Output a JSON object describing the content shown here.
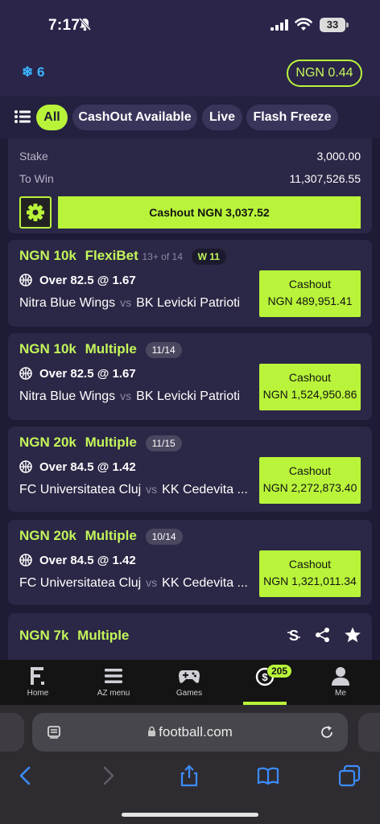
{
  "status_bar": {
    "time": "7:17",
    "battery": "33"
  },
  "header": {
    "freeze_count": "6",
    "balance": "NGN 0.44"
  },
  "filters": [
    {
      "label": "All",
      "active": true
    },
    {
      "label": "CashOut Available",
      "active": false
    },
    {
      "label": "Live",
      "active": false
    },
    {
      "label": "Flash Freeze",
      "active": false
    }
  ],
  "top_card": {
    "stake_label": "Stake",
    "stake_value": "3,000.00",
    "towin_label": "To Win",
    "towin_value": "11,307,526.55",
    "cashout_label": "Cashout NGN 3,037.52"
  },
  "bets": [
    {
      "amount": "NGN 10k",
      "type": "FlexiBet",
      "sub": "13+ of 14",
      "badge": "W 11",
      "selection": "Over 82.5 @ 1.67",
      "home": "Nitra Blue Wings",
      "vs": "vs",
      "away": "BK Levicki Patrioti",
      "cashout_label": "Cashout",
      "cashout_value": "NGN 489,951.41"
    },
    {
      "amount": "NGN 10k",
      "type": "Multiple",
      "badge": "11/14",
      "selection": "Over 82.5 @ 1.67",
      "home": "Nitra Blue Wings",
      "vs": "vs",
      "away": "BK Levicki Patrioti",
      "cashout_label": "Cashout",
      "cashout_value": "NGN 1,524,950.86"
    },
    {
      "amount": "NGN 20k",
      "type": "Multiple",
      "badge": "11/15",
      "selection": "Over 84.5 @ 1.42",
      "home": "FC Universitatea Cluj",
      "vs": "vs",
      "away": "KK Cedevita ...",
      "cashout_label": "Cashout",
      "cashout_value": "NGN 2,272,873.40"
    },
    {
      "amount": "NGN 20k",
      "type": "Multiple",
      "badge": "10/14",
      "selection": "Over 84.5 @ 1.42",
      "home": "FC Universitatea Cluj",
      "vs": "vs",
      "away": "KK Cedevita ...",
      "cashout_label": "Cashout",
      "cashout_value": "NGN 1,321,011.34"
    },
    {
      "amount": "NGN 7k",
      "type": "Multiple"
    }
  ],
  "bottom_nav": [
    {
      "label": "Home",
      "icon": "logo-icon"
    },
    {
      "label": "AZ menu",
      "icon": "menu-icon"
    },
    {
      "label": "Games",
      "icon": "gamepad-icon"
    },
    {
      "label": "",
      "icon": "cashout-icon",
      "badge": "205",
      "active": true
    },
    {
      "label": "Me",
      "icon": "user-icon"
    }
  ],
  "browser": {
    "url": "football.com"
  },
  "colors": {
    "accent": "#b9f43a",
    "background": "#1e1b36",
    "card": "#2b2746",
    "freeze": "#3cb4ff"
  }
}
